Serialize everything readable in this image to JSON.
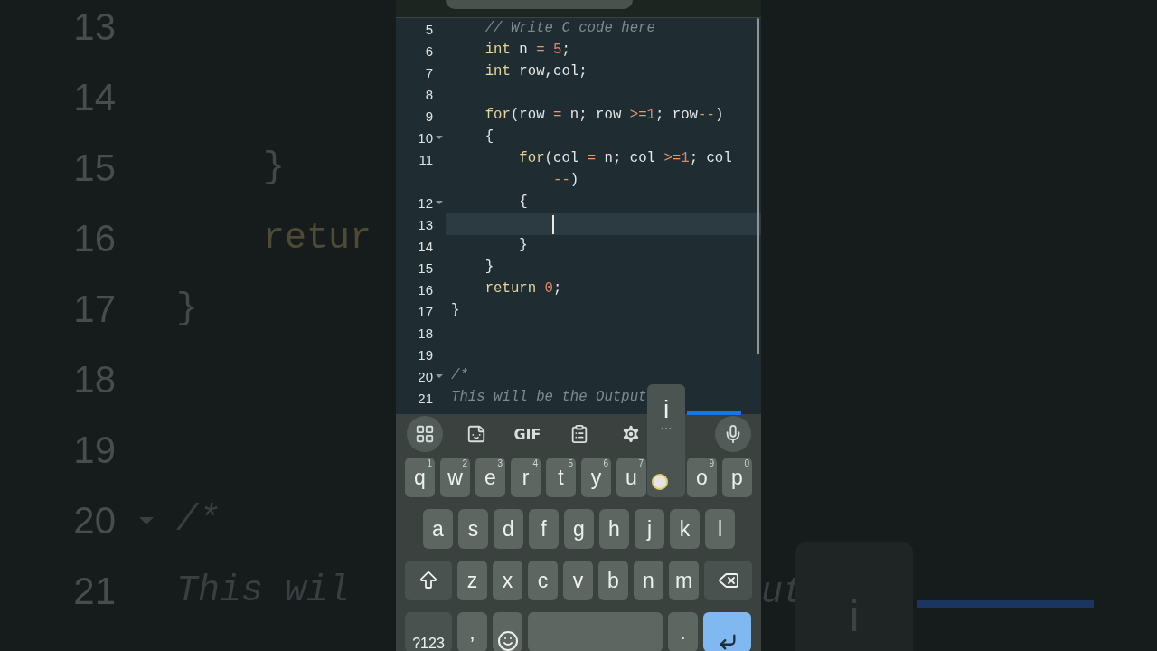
{
  "background": {
    "left_lines": [
      {
        "number": "13",
        "fold": false
      },
      {
        "number": "14",
        "fold": false
      },
      {
        "number": "15",
        "fold": false,
        "code": {
          "text": "    }",
          "kind": "plain"
        }
      },
      {
        "number": "16",
        "fold": false,
        "code": {
          "text": "    retur",
          "kind": "keyword"
        }
      },
      {
        "number": "17",
        "fold": false,
        "code": {
          "text": "}",
          "kind": "plain"
        }
      },
      {
        "number": "18",
        "fold": false
      },
      {
        "number": "19",
        "fold": false
      },
      {
        "number": "20",
        "fold": true,
        "code": {
          "text": "/*",
          "kind": "comment"
        }
      },
      {
        "number": "21",
        "fold": false,
        "code": {
          "text": "This wil",
          "kind": "comment"
        }
      }
    ],
    "right_fragment": "ut",
    "right_preview": "i"
  },
  "editor": {
    "lines": [
      {
        "number": "5",
        "fold": false,
        "current": false,
        "tokens": [
          {
            "text": "    // Write C code here",
            "kind": "comment"
          }
        ]
      },
      {
        "number": "6",
        "fold": false,
        "current": false,
        "tokens": [
          {
            "text": "    int",
            "kind": "keyword"
          },
          {
            "text": " n ",
            "kind": "plain"
          },
          {
            "text": "=",
            "kind": "operator"
          },
          {
            "text": " 5",
            "kind": "number"
          },
          {
            "text": ";",
            "kind": "plain"
          }
        ]
      },
      {
        "number": "7",
        "fold": false,
        "current": false,
        "tokens": [
          {
            "text": "    int",
            "kind": "keyword"
          },
          {
            "text": " row,col;",
            "kind": "plain"
          }
        ]
      },
      {
        "number": "8",
        "fold": false,
        "current": false
      },
      {
        "number": "9",
        "fold": false,
        "current": false,
        "tokens": [
          {
            "text": "    for",
            "kind": "keyword"
          },
          {
            "text": "(row ",
            "kind": "plain"
          },
          {
            "text": "=",
            "kind": "operator"
          },
          {
            "text": " n; row ",
            "kind": "plain"
          },
          {
            "text": ">=",
            "kind": "operator"
          },
          {
            "text": "1",
            "kind": "number"
          },
          {
            "text": "; row",
            "kind": "plain"
          },
          {
            "text": "--",
            "kind": "operator"
          },
          {
            "text": ")",
            "kind": "plain"
          }
        ]
      },
      {
        "number": "10",
        "fold": true,
        "current": false,
        "tokens": [
          {
            "text": "    {",
            "kind": "plain"
          }
        ]
      },
      {
        "number": "11",
        "fold": false,
        "current": false,
        "tokens": [
          {
            "text": "        for",
            "kind": "keyword"
          },
          {
            "text": "(col ",
            "kind": "plain"
          },
          {
            "text": "=",
            "kind": "operator"
          },
          {
            "text": " n; col ",
            "kind": "plain"
          },
          {
            "text": ">=",
            "kind": "operator"
          },
          {
            "text": "1",
            "kind": "number"
          },
          {
            "text": "; col",
            "kind": "plain"
          }
        ],
        "wrap": [
          {
            "text": "            --",
            "kind": "operator"
          },
          {
            "text": ")",
            "kind": "plain"
          }
        ]
      },
      {
        "number": "12",
        "fold": true,
        "current": false,
        "tokens": [
          {
            "text": "        {",
            "kind": "plain"
          }
        ]
      },
      {
        "number": "13",
        "fold": false,
        "current": true
      },
      {
        "number": "14",
        "fold": false,
        "current": false,
        "tokens": [
          {
            "text": "        }",
            "kind": "plain"
          }
        ]
      },
      {
        "number": "15",
        "fold": false,
        "current": false,
        "tokens": [
          {
            "text": "    }",
            "kind": "plain"
          }
        ]
      },
      {
        "number": "16",
        "fold": false,
        "current": false,
        "tokens": [
          {
            "text": "    return",
            "kind": "keyword"
          },
          {
            "text": " 0",
            "kind": "number"
          },
          {
            "text": ";",
            "kind": "plain"
          }
        ]
      },
      {
        "number": "17",
        "fold": false,
        "current": false,
        "tokens": [
          {
            "text": "}",
            "kind": "plain"
          }
        ]
      },
      {
        "number": "18",
        "fold": false,
        "current": false
      },
      {
        "number": "19",
        "fold": false,
        "current": false
      },
      {
        "number": "20",
        "fold": true,
        "current": false,
        "tokens": [
          {
            "text": "/*",
            "kind": "comment"
          }
        ]
      },
      {
        "number": "21",
        "fold": false,
        "current": false,
        "tokens": [
          {
            "text": "This will be the Output",
            "kind": "comment"
          }
        ]
      }
    ]
  },
  "keyboard": {
    "toolbar": [
      {
        "kind": "grid"
      },
      {
        "kind": "sticker"
      },
      {
        "kind": "gif",
        "label": "GIF"
      },
      {
        "kind": "clipboard"
      },
      {
        "kind": "settings"
      },
      {
        "kind": "mic"
      }
    ],
    "top_row": [
      {
        "kind": "letter",
        "label": "q",
        "hint": "1"
      },
      {
        "kind": "letter",
        "label": "w",
        "hint": "2"
      },
      {
        "kind": "letter",
        "label": "e",
        "hint": "3"
      },
      {
        "kind": "letter",
        "label": "r",
        "hint": "4"
      },
      {
        "kind": "letter",
        "label": "t",
        "hint": "5"
      },
      {
        "kind": "letter",
        "label": "y",
        "hint": "6"
      },
      {
        "kind": "letter",
        "label": "u",
        "hint": "7"
      },
      {
        "kind": "preview",
        "label": "i",
        "more": "…"
      },
      {
        "kind": "letter",
        "label": "o",
        "hint": "9"
      },
      {
        "kind": "letter",
        "label": "p",
        "hint": "0"
      }
    ],
    "home_row": [
      {
        "kind": "letter",
        "label": "a"
      },
      {
        "kind": "letter",
        "label": "s"
      },
      {
        "kind": "letter",
        "label": "d"
      },
      {
        "kind": "letter",
        "label": "f"
      },
      {
        "kind": "letter",
        "label": "g"
      },
      {
        "kind": "letter",
        "label": "h"
      },
      {
        "kind": "letter",
        "label": "j"
      },
      {
        "kind": "letter",
        "label": "k"
      },
      {
        "kind": "letter",
        "label": "l"
      }
    ],
    "lower_row": [
      {
        "kind": "shift"
      },
      {
        "kind": "letter",
        "label": "z"
      },
      {
        "kind": "letter",
        "label": "x"
      },
      {
        "kind": "letter",
        "label": "c"
      },
      {
        "kind": "letter",
        "label": "v"
      },
      {
        "kind": "letter",
        "label": "b"
      },
      {
        "kind": "letter",
        "label": "n"
      },
      {
        "kind": "letter",
        "label": "m"
      },
      {
        "kind": "backspace"
      }
    ],
    "bottom_row": [
      {
        "kind": "symbols",
        "label": "?123"
      },
      {
        "kind": "letter",
        "label": ","
      },
      {
        "kind": "emoji"
      },
      {
        "kind": "space"
      },
      {
        "kind": "letter",
        "label": "."
      },
      {
        "kind": "enter"
      }
    ]
  }
}
